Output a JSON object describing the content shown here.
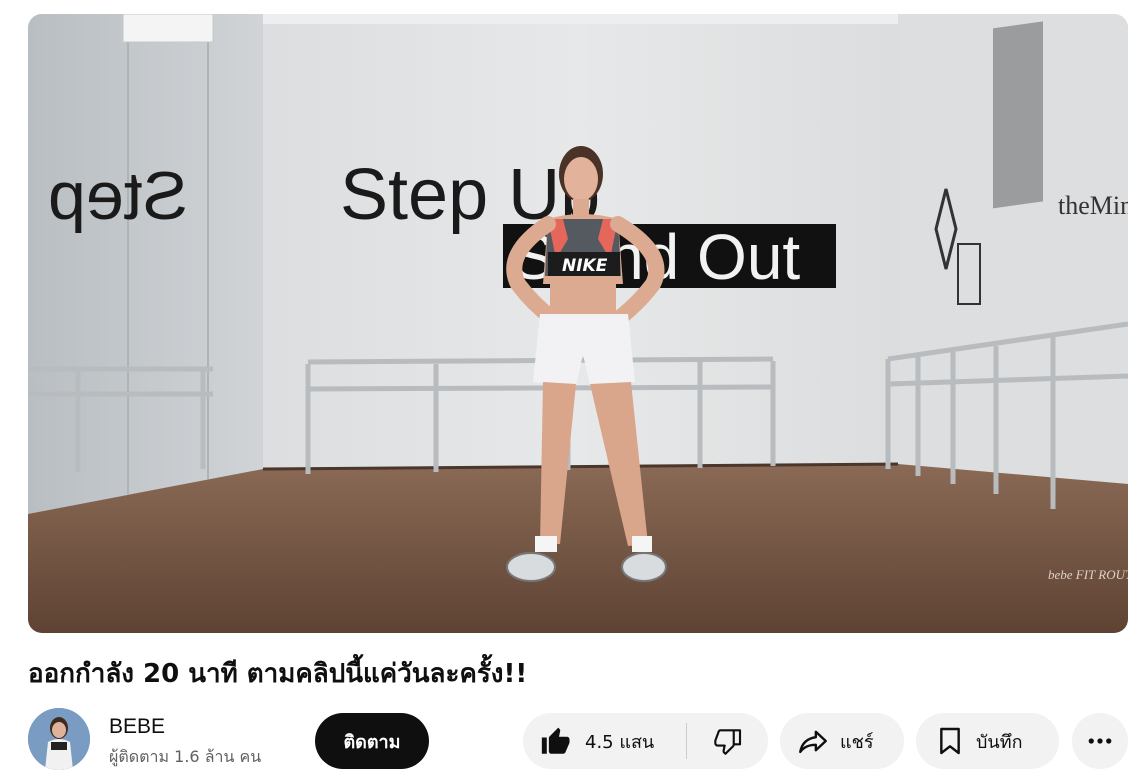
{
  "video": {
    "title": "ออกกำลัง 20 นาที ตามคลิปนี้แค่วันละครั้ง!!",
    "scene_text": {
      "wall_line1": "Step Up",
      "wall_line2": "Stand Out",
      "mirror_text": "Step",
      "shirt_logo": "NIKE",
      "watermark": "bebe FIT ROUTINE"
    }
  },
  "channel": {
    "name": "BEBE",
    "subscribers": "ผู้ติดตาม 1.6 ล้าน คน",
    "subscribe_label": "ติดตาม"
  },
  "actions": {
    "like_count": "4.5 แสน",
    "share_label": "แชร์",
    "save_label": "บันทึก"
  },
  "icons": {
    "like": "thumb-up-icon",
    "dislike": "thumb-down-icon",
    "share": "share-arrow-icon",
    "save": "bookmark-icon",
    "more": "more-horizontal-icon"
  }
}
